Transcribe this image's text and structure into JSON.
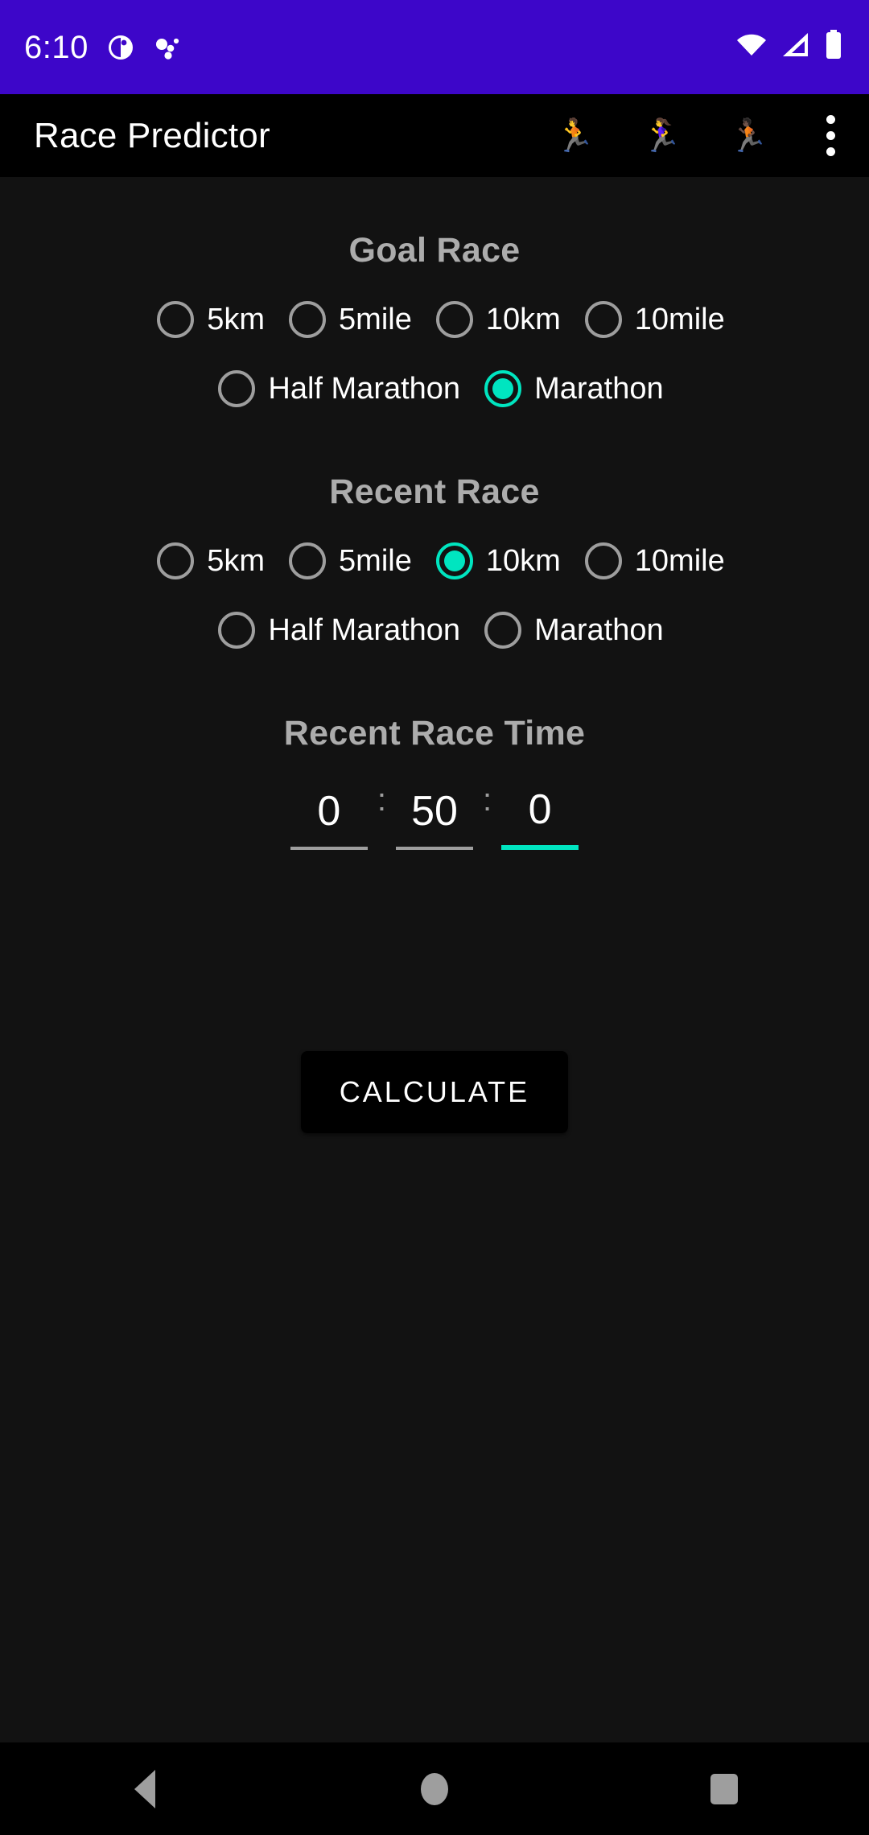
{
  "status_bar": {
    "time": "6:10",
    "background_color": "#3D06C9",
    "left_icons": [
      "notification-circle-icon",
      "dots-cluster-icon"
    ],
    "right_icons": [
      "wifi-icon",
      "cellular-signal-icon",
      "battery-icon"
    ]
  },
  "app_bar": {
    "title": "Race Predictor",
    "background_color": "#000000",
    "actions": [
      {
        "name": "runner-man-icon",
        "glyph": "🏃"
      },
      {
        "name": "runner-woman-icon",
        "glyph": "🏃‍♀️"
      },
      {
        "name": "runner-dark-icon",
        "glyph": "🏃🏿"
      }
    ],
    "overflow_label": "More options"
  },
  "theme": {
    "background": "#121212",
    "accent": "#00E5C0",
    "heading_color": "#ACACAC",
    "label_color": "#FFFFFF",
    "radio_unselected": "#9E9E9E"
  },
  "goal_race": {
    "title": "Goal Race",
    "row1": [
      {
        "label": "5km",
        "selected": false
      },
      {
        "label": "5mile",
        "selected": false
      },
      {
        "label": "10km",
        "selected": false
      },
      {
        "label": "10mile",
        "selected": false
      }
    ],
    "row2": [
      {
        "label": "Half Marathon",
        "selected": false
      },
      {
        "label": "Marathon",
        "selected": true
      }
    ]
  },
  "recent_race": {
    "title": "Recent Race",
    "row1": [
      {
        "label": "5km",
        "selected": false
      },
      {
        "label": "5mile",
        "selected": false
      },
      {
        "label": "10km",
        "selected": true
      },
      {
        "label": "10mile",
        "selected": false
      }
    ],
    "row2": [
      {
        "label": "Half Marathon",
        "selected": false
      },
      {
        "label": "Marathon",
        "selected": false
      }
    ]
  },
  "recent_race_time": {
    "title": "Recent Race Time",
    "separator": ":",
    "hours": {
      "value": "0",
      "placeholder": "0",
      "focused": false
    },
    "minutes": {
      "value": "50",
      "placeholder": "0",
      "focused": false
    },
    "seconds": {
      "value": "0",
      "placeholder": "0",
      "focused": true
    }
  },
  "calculate_button": {
    "label": "CALCULATE"
  },
  "nav_bar": {
    "back_label": "Back",
    "home_label": "Home",
    "recents_label": "Recents"
  }
}
